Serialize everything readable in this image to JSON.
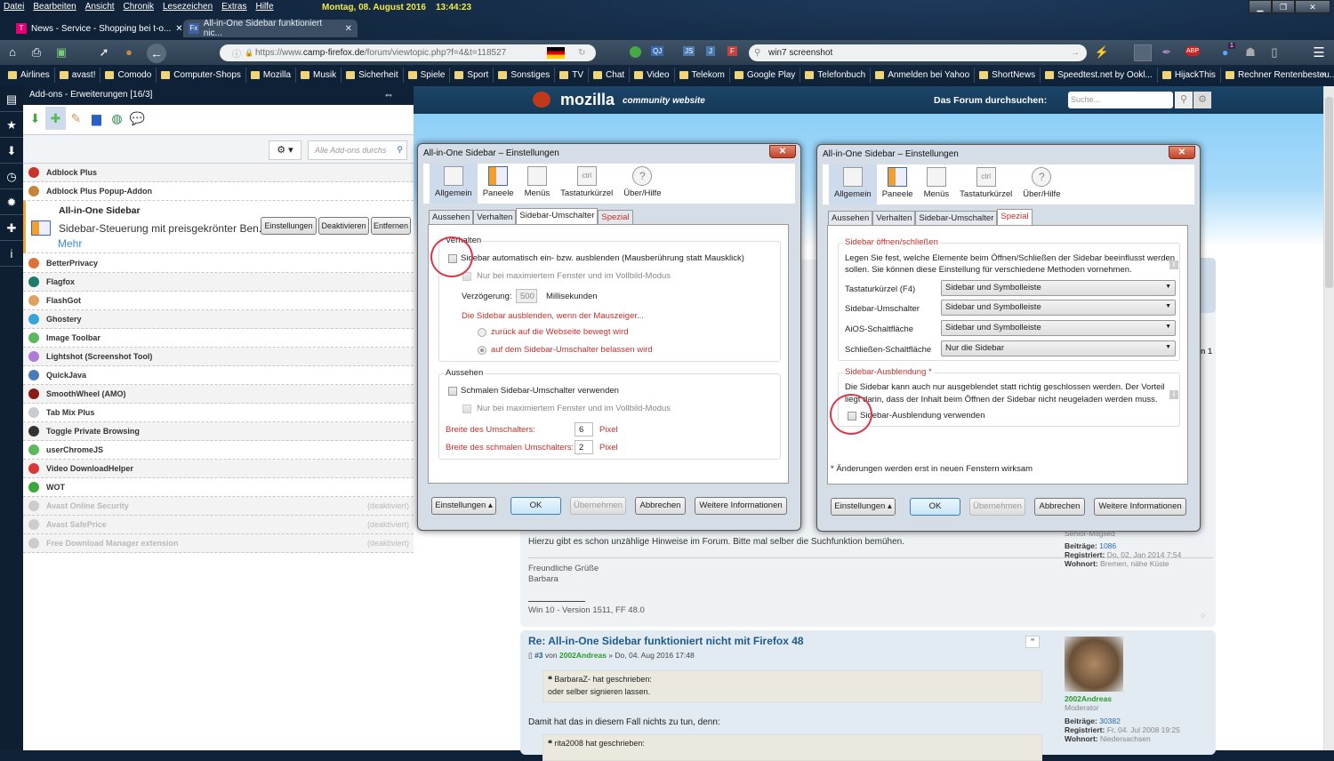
{
  "menu": [
    "Datei",
    "Bearbeiten",
    "Ansicht",
    "Chronik",
    "Lesezeichen",
    "Extras",
    "Hilfe"
  ],
  "clock": {
    "date": "Montag, 08. August 2016",
    "time": "13:44:23"
  },
  "tabs": [
    {
      "label": "News - Service - Shopping bei t-o...",
      "favicon": "T"
    },
    {
      "label": "All-in-One Sidebar funktioniert nic...",
      "favicon": "Fx"
    }
  ],
  "url": {
    "prefix": "https://www.",
    "domain": "camp-firefox.de",
    "path": "/forum/viewtopic.php?f=4&t=118527"
  },
  "search": {
    "value": "win7 screenshot"
  },
  "toolbar_badges": {
    "js": "JS",
    "j": "J",
    "f": "F",
    "qj": "QJ",
    "abp": "ABP",
    "notif": "1"
  },
  "bookmarks": [
    "Airlines",
    "avast!",
    "Comodo",
    "Computer-Shops",
    "Mozilla",
    "Musik",
    "Sicherheit",
    "Spiele",
    "Sport",
    "Sonstiges",
    "TV",
    "Chat",
    "Video",
    "Telekom",
    "Google Play",
    "Telefonbuch",
    "Anmelden bei Yahoo",
    "ShortNews",
    "Speedtest.net by Ookl...",
    "HijackThis",
    "Rechner Rentenbesteu..."
  ],
  "sidebar": {
    "title": "Add-ons - Erweiterungen [16/3]",
    "search_placeholder": "Alle Add-ons durchs",
    "expanded": {
      "name": "All-in-One Sidebar",
      "desc": "Sidebar-Steuerung mit preisgekrönter Ben...",
      "more": "Mehr",
      "buttons": [
        "Einstellungen",
        "Deaktivieren",
        "Entfernen"
      ]
    },
    "addons_top": [
      {
        "name": "Adblock Plus",
        "color": "#c8352c"
      },
      {
        "name": "Adblock Plus Popup-Addon",
        "color": "#c9833c"
      }
    ],
    "addons": [
      {
        "name": "BetterPrivacy",
        "color": "#d8743a"
      },
      {
        "name": "Flagfox",
        "color": "#1f7a6a"
      },
      {
        "name": "FlashGot",
        "color": "#e0a060"
      },
      {
        "name": "Ghostery",
        "color": "#38a4d8"
      },
      {
        "name": "Image Toolbar",
        "color": "#5cb85c"
      },
      {
        "name": "Lightshot (Screenshot Tool)",
        "color": "#b07ad8"
      },
      {
        "name": "QuickJava",
        "color": "#4a7ab8"
      },
      {
        "name": "SmoothWheel (AMO)",
        "color": "#8a1a1a"
      },
      {
        "name": "Tab Mix Plus",
        "color": "#c8ccd0"
      },
      {
        "name": "Toggle Private Browsing",
        "color": "#333333"
      },
      {
        "name": "userChromeJS",
        "color": "#5cb85c"
      },
      {
        "name": "Video DownloadHelper",
        "color": "#d83a3a"
      },
      {
        "name": "WOT",
        "color": "#3aa83a"
      }
    ],
    "disabled_addons": [
      {
        "name": "Avast Online Security",
        "status": "(deaktiviert)"
      },
      {
        "name": "Avast SafePrice",
        "status": "(deaktiviert)"
      },
      {
        "name": "Free Download Manager extension",
        "status": "(deaktiviert)"
      }
    ]
  },
  "web": {
    "logo": "mozilla",
    "logo_sub": "community website",
    "search_label": "Das Forum durchsuchen:",
    "search_placeholder": "Suche...",
    "post2": {
      "line1": "Hierzu gibt es schon unzählige Hinweise im Forum. Bitte mal selber die Suchfunktion bemühen.",
      "greet": "Freundliche Grüße",
      "name": "Barbara",
      "sig": "Win 10 - Version 1511, FF 48.0",
      "rank": "Senior-Mitglied",
      "posts_label": "Beiträge:",
      "posts": "1086",
      "reg_label": "Registriert:",
      "reg": "Do, 02. Jan 2014 7:54",
      "loc_label": "Wohnort:",
      "loc": "Bremen, nähe Küste"
    },
    "post3": {
      "title": "Re: All-in-One Sidebar funktioniert nicht mit Firefox 48",
      "num": "#3",
      "von": "von",
      "author": "2002Andreas",
      "date": "» Do, 04. Aug 2016 17:48",
      "quote1_author": "BarbaraZ- hat geschrieben:",
      "quote1_text": "oder selber signieren lassen.",
      "text": "Damit hat das in diesem Fall nichts zu tun, denn:",
      "quote2_author": "rita2008 hat geschrieben:",
      "rank": "Moderator",
      "posts_label": "Beiträge:",
      "posts": "30382",
      "reg_label": "Registriert:",
      "reg": "Fr, 04. Jul 2008 19:25",
      "loc_label": "Wohnort:",
      "loc": "Niedersachsen"
    }
  },
  "dialog": {
    "title": "All-in-One Sidebar – Einstellungen",
    "toolbar": [
      "Allgemein",
      "Paneele",
      "Menüs",
      "Tastaturkürzel",
      "Über/Hilfe"
    ],
    "tabs": [
      "Aussehen",
      "Verhalten",
      "Sidebar-Umschalter",
      "Spezial"
    ],
    "buttons": [
      "Einstellungen ▴",
      "OK",
      "Übernehmen",
      "Abbrechen",
      "Weitere Informationen"
    ]
  },
  "dialog1": {
    "group1": "Verhalten",
    "auto": "Sidebar automatisch ein- bzw. ausblenden (Mausberührung statt Mausklick)",
    "only_max": "Nur bei maximiertem Fenster und im Vollbild-Modus",
    "delay_label": "Verzögerung:",
    "delay": "500",
    "delay_unit": "Millisekunden",
    "hide_when": "Die Sidebar ausblenden, wenn der Mauszeiger...",
    "radio1": "zurück auf die Webseite bewegt wird",
    "radio2": "auf dem Sidebar-Umschalter belassen wird",
    "group2": "Aussehen",
    "narrow": "Schmalen Sidebar-Umschalter verwenden",
    "only_max2": "Nur bei maximiertem Fenster und im Vollbild-Modus",
    "width_label": "Breite des Umschalters:",
    "width": "6",
    "narrow_width_label": "Breite des schmalen Umschalters:",
    "narrow_width": "2",
    "unit": "Pixel"
  },
  "dialog2": {
    "group1": "Sidebar öffnen/schließen",
    "desc1": "Legen Sie fest, welche Elemente beim Öffnen/Schließen der Sidebar beeinflusst werden",
    "desc2": "sollen. Sie können diese Einstellung für verschiedene Methoden vornehmen.",
    "rows": [
      {
        "label": "Tastaturkürzel (F4)",
        "value": "Sidebar und Symbolleiste"
      },
      {
        "label": "Sidebar-Umschalter",
        "value": "Sidebar und Symbolleiste"
      },
      {
        "label": "AiOS-Schaltfläche",
        "value": "Sidebar und Symbolleiste"
      },
      {
        "label": "Schließen-Schaltfläche",
        "value": "Nur die Sidebar"
      }
    ],
    "group2": "Sidebar-Ausblendung *",
    "desc3": "Die Sidebar kann auch nur ausgeblendet statt richtig geschlossen werden. Der Vorteil",
    "desc4": "liegt darin, dass der Inhalt beim Öffnen der Sidebar nicht neugeladen werden muss.",
    "use_hide": "Sidebar-Ausblendung verwenden",
    "note": "* Änderungen werden erst in neuen Fenstern wirksam"
  }
}
